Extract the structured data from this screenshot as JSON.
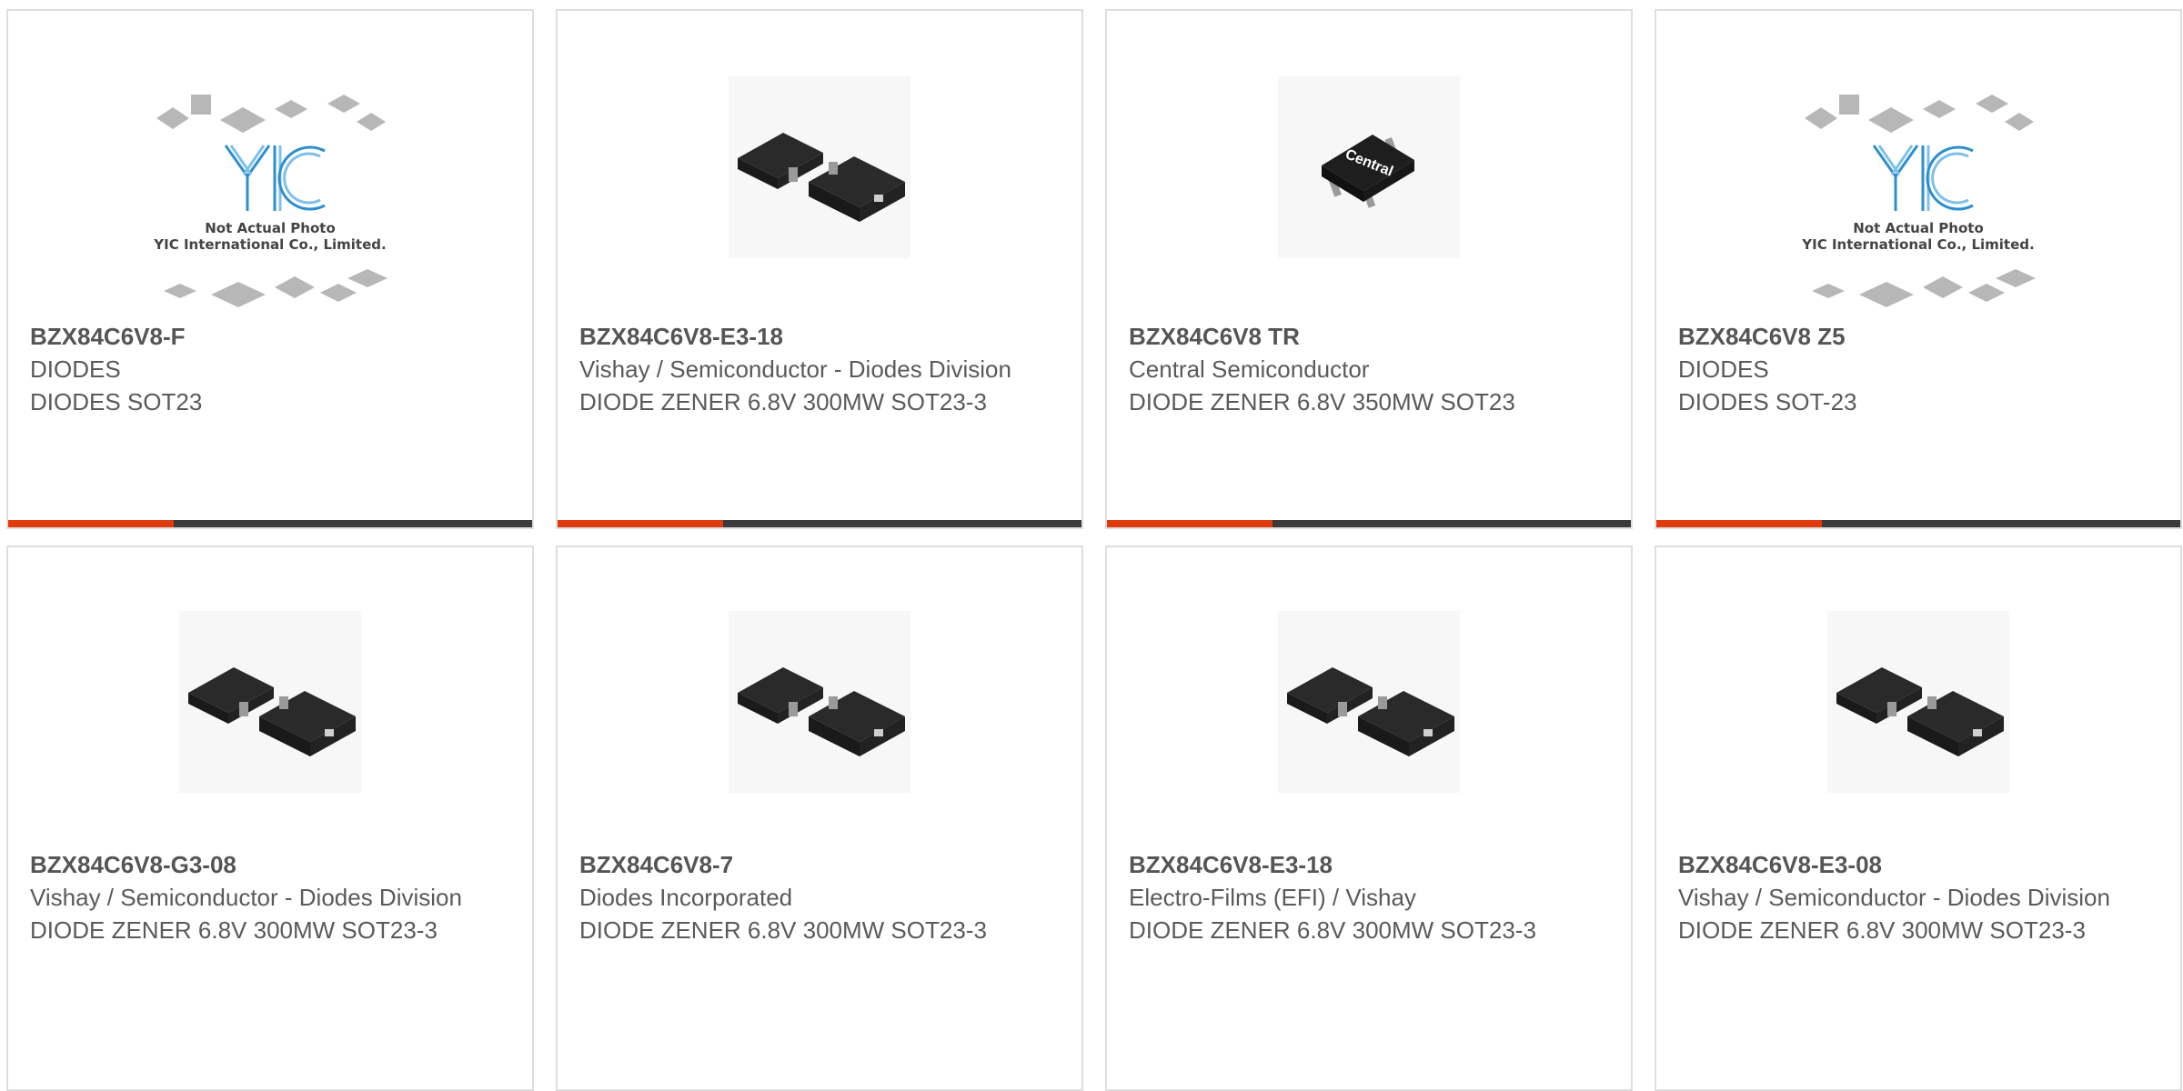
{
  "products": [
    {
      "part": "BZX84C6V8-F",
      "manufacturer": "DIODES",
      "description": "DIODES SOT23",
      "image": "yic-placeholder",
      "placeholder_line1": "Not Actual Photo",
      "placeholder_line2": "YIC International Co., Limited.",
      "placeholder_logo": "YIC"
    },
    {
      "part": "BZX84C6V8-E3-18",
      "manufacturer": "Vishay / Semiconductor - Diodes Division",
      "description": "DIODE ZENER 6.8V 300MW SOT23-3",
      "image": "sot23-pair"
    },
    {
      "part": "BZX84C6V8 TR",
      "manufacturer": "Central Semiconductor",
      "description": "DIODE ZENER 6.8V 350MW SOT23",
      "image": "sot23-central",
      "chip_label": "Central"
    },
    {
      "part": "BZX84C6V8 Z5",
      "manufacturer": "DIODES",
      "description": "DIODES SOT-23",
      "image": "yic-placeholder",
      "placeholder_line1": "Not Actual Photo",
      "placeholder_line2": "YIC International Co., Limited.",
      "placeholder_logo": "YIC"
    },
    {
      "part": "BZX84C6V8-G3-08",
      "manufacturer": "Vishay / Semiconductor - Diodes Division",
      "description": "DIODE ZENER 6.8V 300MW SOT23-3",
      "image": "sot23-pair"
    },
    {
      "part": "BZX84C6V8-7",
      "manufacturer": "Diodes Incorporated",
      "description": "DIODE ZENER 6.8V 300MW SOT23-3",
      "image": "sot23-pair"
    },
    {
      "part": "BZX84C6V8-E3-18",
      "manufacturer": "Electro-Films (EFI) / Vishay",
      "description": "DIODE ZENER 6.8V 300MW SOT23-3",
      "image": "sot23-pair"
    },
    {
      "part": "BZX84C6V8-E3-08",
      "manufacturer": "Vishay / Semiconductor - Diodes Division",
      "description": "DIODE ZENER 6.8V 300MW SOT23-3",
      "image": "sot23-pair"
    }
  ],
  "colors": {
    "accent": "#e03a0f",
    "bar": "#3b3b3b",
    "border": "#dedede",
    "text": "#5a5a5a"
  }
}
